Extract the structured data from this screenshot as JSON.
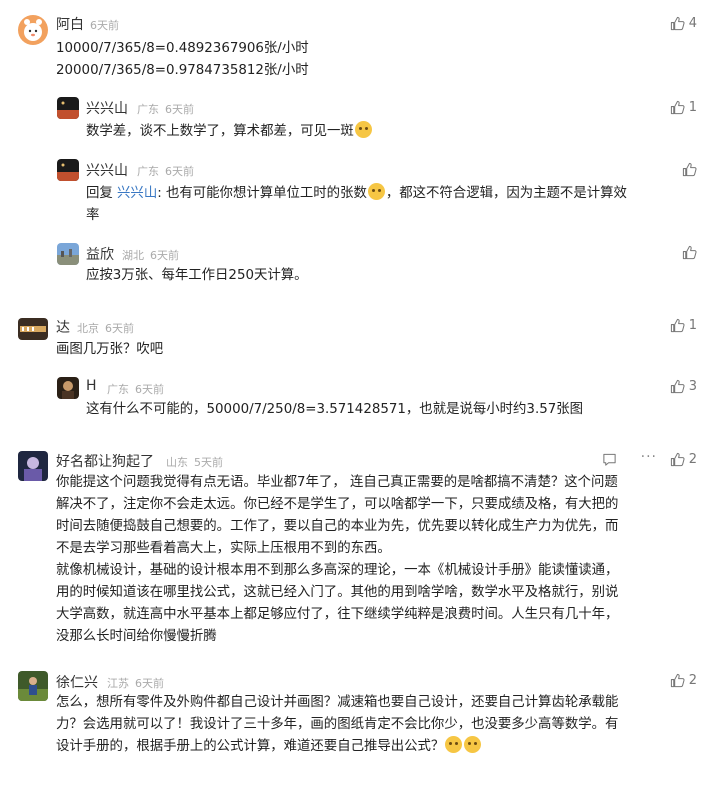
{
  "comments": [
    {
      "name": "阿白",
      "location": "",
      "time": "6天前",
      "likes": "4",
      "lines": [
        "10000/7/365/8=0.4892367906张/小时",
        "20000/7/365/8=0.9784735812张/小时"
      ]
    },
    {
      "name": "兴兴山",
      "location": "广东",
      "time": "6天前",
      "likes": "1",
      "text": "数学差，谈不上数学了，算术都差，可见一斑"
    },
    {
      "name": "兴兴山",
      "location": "广东",
      "time": "6天前",
      "likes": "",
      "reply_prefix": "回复 ",
      "mention": "兴兴山",
      "text_a": ": 也有可能你想计算单位工时的张数",
      "text_b": "，都这不符合逻辑，因为主题不是计算效",
      "text_c": "率"
    },
    {
      "name": "益欣",
      "location": "湖北",
      "time": "6天前",
      "likes": "",
      "text": "应按3万张、每年工作日250天计算。"
    },
    {
      "name": "达",
      "location": "北京",
      "time": "6天前",
      "likes": "1",
      "text": "画图几万张？吹吧"
    },
    {
      "name": "H",
      "location": "广东",
      "time": "6天前",
      "likes": "3",
      "text": "这有什么不可能的，50000/7/250/8=3.571428571，也就是说每小时约3.57张图"
    },
    {
      "name": "好名都让狗起了",
      "location": "山东",
      "time": "5天前",
      "likes": "2",
      "lines": [
        "你能提这个问题我觉得有点无语。毕业都7年了，  连自己真正需要的是啥都搞不清楚？这个问题",
        "解决不了，注定你不会走太远。你已经不是学生了，可以啥都学一下，只要成绩及格，有大把的",
        "时间去随便捣鼓自己想要的。工作了，要以自己的本业为先，优先要以转化成生产力为优先，而",
        "不是去学习那些看着高大上，实际上压根用不到的东西。",
        "就像机械设计，基础的设计根本用不到那么多高深的理论，一本《机械设计手册》能读懂读通，",
        "用的时候知道该在哪里找公式，这就已经入门了。其他的用到啥学啥，数学水平及格就行，别说",
        "大学高数，就连高中水平基本上都足够应付了，往下继续学纯粹是浪费时间。人生只有几十年，",
        "没那么长时间给你慢慢折腾"
      ]
    },
    {
      "name": "徐仁兴",
      "location": "江苏",
      "time": "6天前",
      "likes": "2",
      "lines": [
        "怎么，想所有零件及外购件都自己设计并画图？减速箱也要自己设计，还要自己计算齿轮承载能",
        "力？会选用就可以了！我设计了三十多年，画的图纸肯定不会比你少，也没要多少高等数学。有",
        "设计手册的，根据手册上的公式计算，难道还要自己推导出公式？"
      ]
    }
  ],
  "icons": {
    "like": "thumbs-up-icon",
    "reply": "reply-bubble-icon",
    "more": "more-dots-icon"
  }
}
